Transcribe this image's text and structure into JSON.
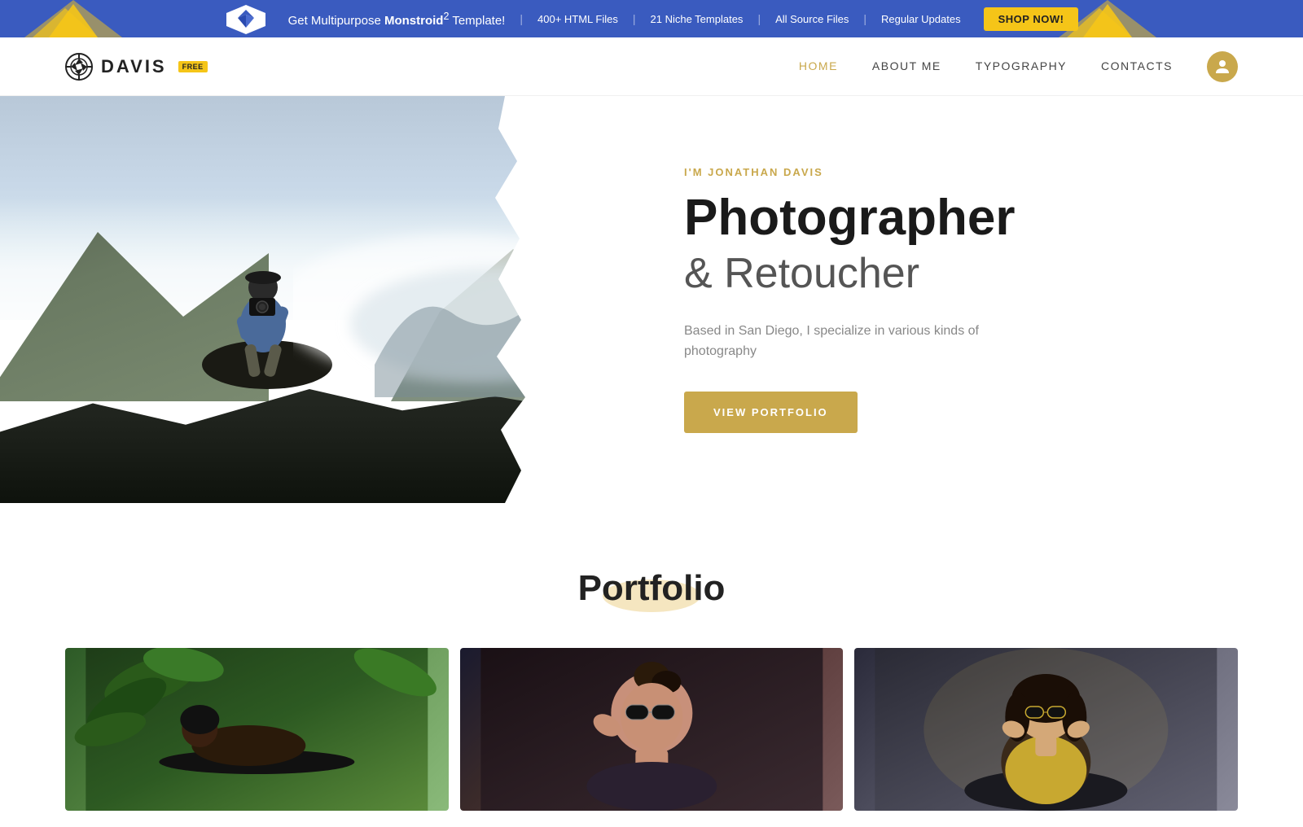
{
  "banner": {
    "text_prefix": "Get Multipurpose ",
    "brand": "Monstroid",
    "superscript": "2",
    "text_suffix": " Template!",
    "features": [
      "400+ HTML Files",
      "21 Niche Templates",
      "All Source Files",
      "Regular Updates"
    ],
    "cta_label": "SHOP NOW!"
  },
  "navbar": {
    "logo_text": "DAVIS",
    "logo_badge": "FREE",
    "links": [
      {
        "label": "HOME",
        "active": true
      },
      {
        "label": "ABOUT ME",
        "active": false
      },
      {
        "label": "TYPOGRAPHY",
        "active": false
      },
      {
        "label": "CONTACTS",
        "active": false
      }
    ]
  },
  "hero": {
    "subtitle": "I'M JONATHAN DAVIS",
    "title_bold": "Photographer",
    "title_light": "& Retoucher",
    "description": "Based in San Diego, I specialize in various kinds of photography",
    "cta_label": "VIEW PORTFOLIO"
  },
  "portfolio": {
    "section_title": "Portfolio",
    "cards": [
      {
        "id": 1,
        "alt": "woman in greenery"
      },
      {
        "id": 2,
        "alt": "woman with sunglasses"
      },
      {
        "id": 3,
        "alt": "woman in yellow"
      }
    ]
  },
  "colors": {
    "accent_gold": "#c9a84c",
    "banner_blue": "#3a5bbf",
    "cta_yellow": "#f5c518",
    "text_dark": "#1a1a1a",
    "text_mid": "#555",
    "text_light": "#888"
  }
}
